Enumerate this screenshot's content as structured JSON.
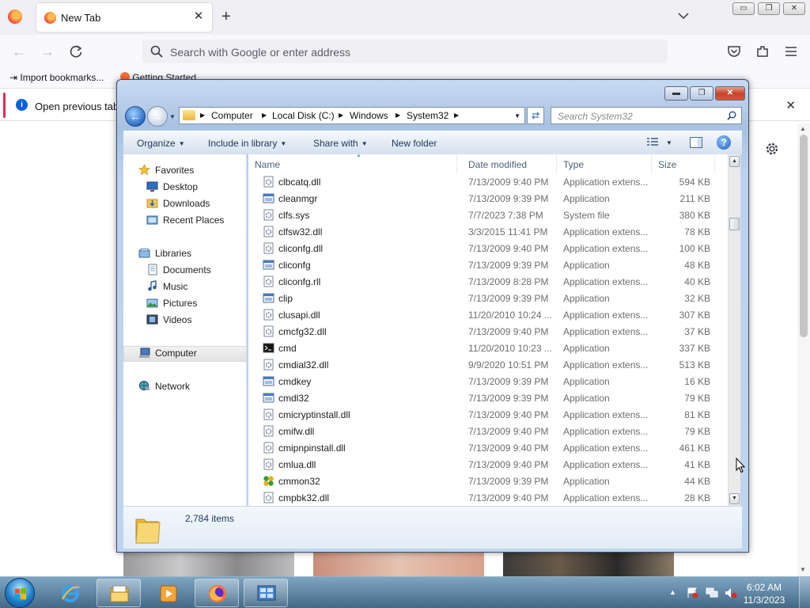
{
  "browser": {
    "tab_title": "New Tab",
    "new_tab_glyph": "+",
    "close_glyph": "✕",
    "url_placeholder": "Search with Google or enter address",
    "bookmarks": [
      {
        "label": "Import bookmarks...",
        "icon": "import-icon"
      },
      {
        "label": "Getting Started",
        "icon": "firefox-icon"
      }
    ],
    "infobar_text": "Open previous tabs",
    "accent": "#e22850",
    "window_controls": {
      "minimize": "▭",
      "restore": "❐",
      "close": "✕"
    }
  },
  "explorer": {
    "breadcrumb": [
      "Computer",
      "Local Disk (C:)",
      "Windows",
      "System32"
    ],
    "search_placeholder": "Search System32",
    "toolbar": {
      "organize": "Organize",
      "include_in_library": "Include in library",
      "share_with": "Share with",
      "new_folder": "New folder"
    },
    "nav": {
      "favorites": "Favorites",
      "desktop": "Desktop",
      "downloads": "Downloads",
      "recent_places": "Recent Places",
      "libraries": "Libraries",
      "documents": "Documents",
      "music": "Music",
      "pictures": "Pictures",
      "videos": "Videos",
      "computer": "Computer",
      "network": "Network"
    },
    "columns": {
      "name": "Name",
      "date_modified": "Date modified",
      "type": "Type",
      "size": "Size"
    },
    "files": [
      {
        "name": "clbcatq.dll",
        "date": "7/13/2009 9:40 PM",
        "type": "Application extens...",
        "size": "594 KB",
        "icon": "dll"
      },
      {
        "name": "cleanmgr",
        "date": "7/13/2009 9:39 PM",
        "type": "Application",
        "size": "211 KB",
        "icon": "app"
      },
      {
        "name": "clfs.sys",
        "date": "7/7/2023 7:38 PM",
        "type": "System file",
        "size": "380 KB",
        "icon": "sys"
      },
      {
        "name": "clfsw32.dll",
        "date": "3/3/2015 11:41 PM",
        "type": "Application extens...",
        "size": "78 KB",
        "icon": "dll"
      },
      {
        "name": "cliconfg.dll",
        "date": "7/13/2009 9:40 PM",
        "type": "Application extens...",
        "size": "100 KB",
        "icon": "dll"
      },
      {
        "name": "cliconfg",
        "date": "7/13/2009 9:39 PM",
        "type": "Application",
        "size": "48 KB",
        "icon": "app"
      },
      {
        "name": "cliconfg.rll",
        "date": "7/13/2009 8:28 PM",
        "type": "Application extens...",
        "size": "40 KB",
        "icon": "dll"
      },
      {
        "name": "clip",
        "date": "7/13/2009 9:39 PM",
        "type": "Application",
        "size": "32 KB",
        "icon": "app"
      },
      {
        "name": "clusapi.dll",
        "date": "11/20/2010 10:24 ...",
        "type": "Application extens...",
        "size": "307 KB",
        "icon": "dll"
      },
      {
        "name": "cmcfg32.dll",
        "date": "7/13/2009 9:40 PM",
        "type": "Application extens...",
        "size": "37 KB",
        "icon": "dll"
      },
      {
        "name": "cmd",
        "date": "11/20/2010 10:23 ...",
        "type": "Application",
        "size": "337 KB",
        "icon": "cmd"
      },
      {
        "name": "cmdial32.dll",
        "date": "9/9/2020 10:51 PM",
        "type": "Application extens...",
        "size": "513 KB",
        "icon": "dll"
      },
      {
        "name": "cmdkey",
        "date": "7/13/2009 9:39 PM",
        "type": "Application",
        "size": "16 KB",
        "icon": "app"
      },
      {
        "name": "cmdl32",
        "date": "7/13/2009 9:39 PM",
        "type": "Application",
        "size": "79 KB",
        "icon": "app"
      },
      {
        "name": "cmicryptinstall.dll",
        "date": "7/13/2009 9:40 PM",
        "type": "Application extens...",
        "size": "81 KB",
        "icon": "dll"
      },
      {
        "name": "cmifw.dll",
        "date": "7/13/2009 9:40 PM",
        "type": "Application extens...",
        "size": "79 KB",
        "icon": "dll"
      },
      {
        "name": "cmipnpinstall.dll",
        "date": "7/13/2009 9:40 PM",
        "type": "Application extens...",
        "size": "461 KB",
        "icon": "dll"
      },
      {
        "name": "cmlua.dll",
        "date": "7/13/2009 9:40 PM",
        "type": "Application extens...",
        "size": "41 KB",
        "icon": "dll"
      },
      {
        "name": "cmmon32",
        "date": "7/13/2009 9:39 PM",
        "type": "Application",
        "size": "44 KB",
        "icon": "app-green"
      },
      {
        "name": "cmpbk32.dll",
        "date": "7/13/2009 9:40 PM",
        "type": "Application extens...",
        "size": "28 KB",
        "icon": "dll"
      }
    ],
    "item_count": "2,784 items"
  },
  "taskbar": {
    "time": "6:02 AM",
    "date": "11/3/2023",
    "apps": [
      "internet-explorer",
      "windows-explorer",
      "media-player",
      "firefox",
      "control-panel"
    ]
  }
}
